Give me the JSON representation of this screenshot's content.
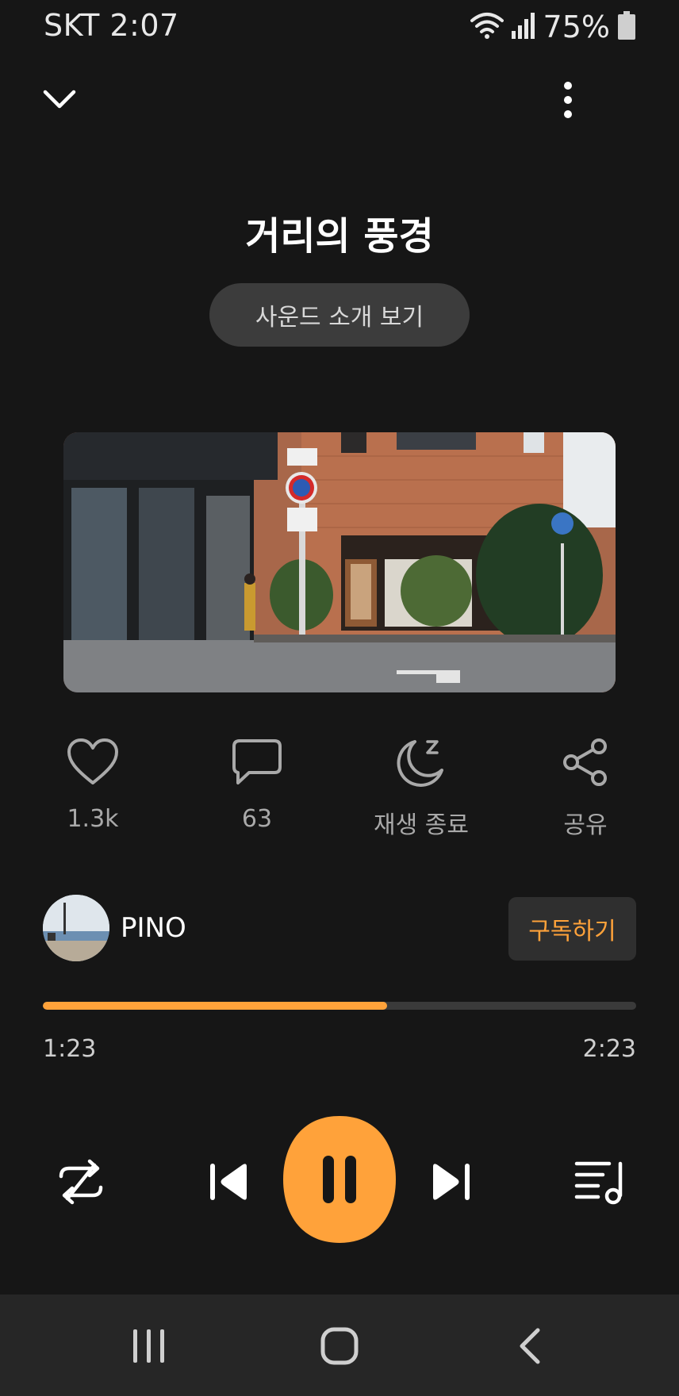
{
  "status_bar": {
    "carrier_time": "SKT 2:07",
    "battery": "75%",
    "icons": [
      "wifi-icon",
      "signal-icon",
      "battery-icon"
    ]
  },
  "header": {
    "collapse_icon": "chevron-down-icon",
    "more_icon": "more-vertical-icon"
  },
  "track": {
    "title": "거리의 풍경",
    "intro_button": "사운드 소개 보기"
  },
  "actions": [
    {
      "icon": "heart-icon",
      "label": "1.3k"
    },
    {
      "icon": "comment-icon",
      "label": "63"
    },
    {
      "icon": "sleep-timer-icon",
      "label": "재생 종료"
    },
    {
      "icon": "share-icon",
      "label": "공유"
    }
  ],
  "channel": {
    "name": "PINO",
    "subscribe_label": "구독하기"
  },
  "progress": {
    "fraction": 0.58,
    "current_time": "1:23",
    "total_time": "2:23"
  },
  "controls": [
    "repeat-icon",
    "previous-icon",
    "pause-icon",
    "next-icon",
    "queue-icon"
  ],
  "nav_bar": [
    "recents-icon",
    "home-icon",
    "back-icon"
  ],
  "colors": {
    "accent": "#ffa23a",
    "background": "#161616",
    "nav_background": "#262626",
    "button_background": "#3c3c3c"
  }
}
